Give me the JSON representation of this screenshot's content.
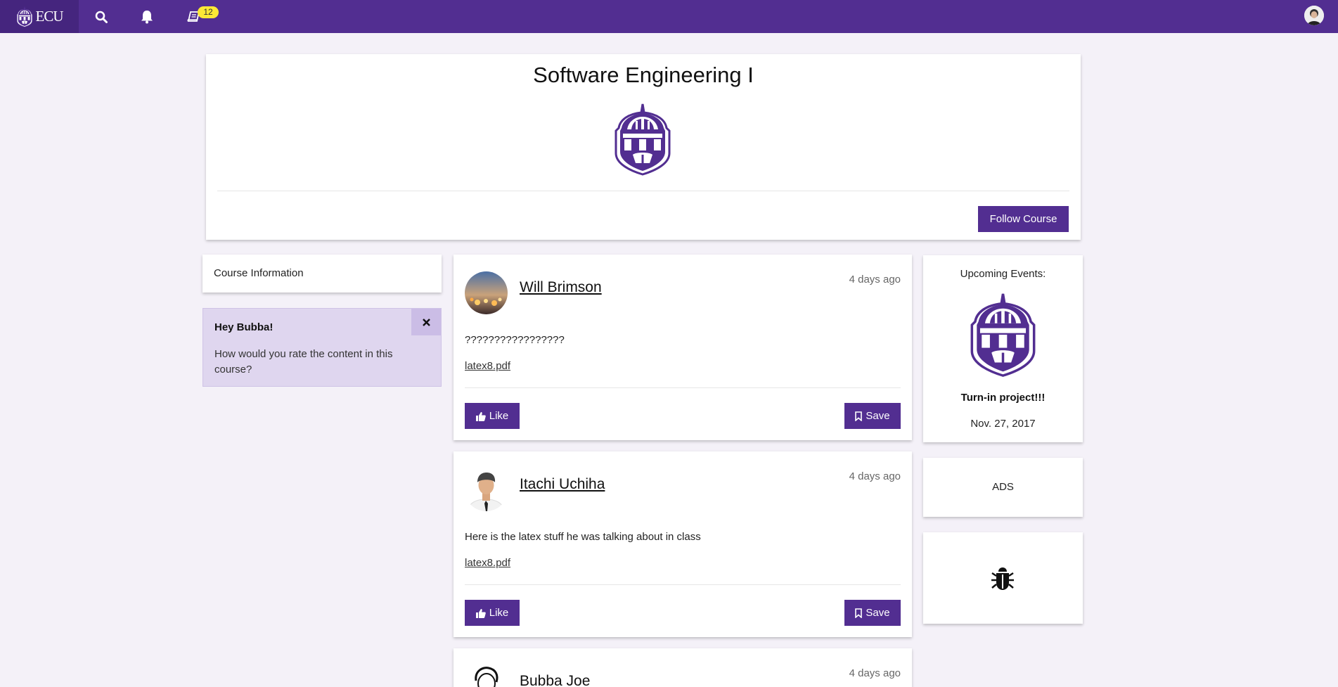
{
  "nav": {
    "brand": "ECU",
    "badge_count": "12",
    "accent": "#522e91",
    "badge_color": "#fde835"
  },
  "course": {
    "title": "Software Engineering I",
    "follow_label": "Follow Course"
  },
  "sidebar": {
    "course_info_label": "Course Information",
    "rating_prompt": {
      "greeting": "Hey Bubba!",
      "question": "How would you rate the content in this course?",
      "close_label": "×"
    }
  },
  "posts": [
    {
      "author": "Will Brimson",
      "time": "4 days ago",
      "text": "?????????????????",
      "attachment": "latex8.pdf",
      "like_label": "Like",
      "save_label": "Save"
    },
    {
      "author": "Itachi Uchiha",
      "time": "4 days ago",
      "text": "Here is the latex stuff he was talking about in class",
      "attachment": "latex8.pdf",
      "like_label": "Like",
      "save_label": "Save"
    },
    {
      "author": "Bubba Joe",
      "time": "4 days ago"
    }
  ],
  "events": {
    "heading": "Upcoming Events:",
    "title": "Turn-in project!!!",
    "date": "Nov. 27, 2017"
  },
  "ads": {
    "label": "ADS"
  },
  "icons": {
    "nav": [
      "ecu-logo-icon",
      "search-icon",
      "bell-icon",
      "book-icon",
      "user-avatar"
    ],
    "bug": "bug-icon"
  }
}
